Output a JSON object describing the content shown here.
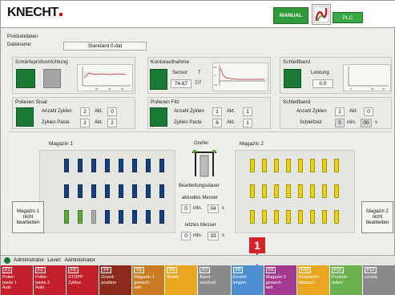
{
  "header": {
    "logo": "KNECHT",
    "manual_label": "MANUAL",
    "plc_label": "PLC",
    "colors": {
      "manual": "#2e9a3a",
      "plc": "#38a845",
      "logo_dot": "#d11111"
    }
  },
  "product": {
    "title": "Produktdaten",
    "file_label": "Dateiname:",
    "file_value": "Standard 0.dat"
  },
  "sections": {
    "sharpness": {
      "title": "Schärfeprüfvorrichtung"
    },
    "contour": {
      "title": "Konturaufnahme",
      "sensor_label": "Sensor",
      "sensor_unit": "T",
      "value1": "74.67",
      "value2": "7/7"
    },
    "belt1": {
      "title": "Schleifband",
      "power_label": "Leistung",
      "power_value": "0.0"
    },
    "sisal": {
      "title": "Polieren Sisal",
      "cycles_label": "Anzahl Zyklen",
      "cycles_value": "2",
      "akt_label": "Akt.",
      "cycles_akt": "0",
      "paste_label": "Zyklen Paste",
      "paste_value": "2",
      "paste_akt": "2"
    },
    "filz": {
      "title": "Polieren Filz",
      "cycles_label": "Anzahl Zyklen",
      "cycles_value": "1",
      "akt_label": "Akt.",
      "cycles_akt": "1",
      "paste_label": "Zyklen Paste",
      "paste_value": "6",
      "paste_akt": "1"
    },
    "belt2": {
      "title": "Schleifband",
      "cycles_label": "Anzahl Zyklen",
      "cycles_value": "1",
      "akt_label": "Akt.",
      "cycles_akt": "0",
      "time_label": "Schleifzeit",
      "min_value": "0",
      "min_label": "min.",
      "sec_value": "00",
      "sec_label": "s"
    }
  },
  "magazines": {
    "m1_title": "Magazin 1",
    "m2_title": "Magazin 2",
    "gripper_label": "Greifer",
    "duration_label": "Bearbeitungsdauer",
    "current_label": "aktuelles Messer",
    "current_min": "0",
    "current_sec": "04",
    "last_label": "letztes Messer",
    "last_min": "0",
    "last_sec": "33",
    "min_label": "min.",
    "sec_label": "s",
    "m1_button": "Magazin 1\nnicht\nbearbeiten",
    "m2_button": "Magazin 2\nnicht\nbearbeiten",
    "m1_rows": [
      [
        "blue",
        "blue",
        "blue",
        "blue",
        "blue",
        "blue",
        "blue",
        "blue"
      ],
      [
        "blue",
        "blue",
        "blue",
        "blue",
        "blue",
        "blue",
        "blue",
        "blue"
      ],
      [
        "green",
        "green",
        "grey",
        "blue",
        "blue",
        "blue",
        "blue",
        "blue"
      ]
    ],
    "m2_rows": [
      [
        "yellow",
        "yellow",
        "yellow",
        "yellow",
        "yellow",
        "yellow",
        "yellow",
        "yellow"
      ],
      [
        "yellow",
        "yellow",
        "yellow",
        "yellow",
        "yellow",
        "yellow",
        "yellow",
        "yellow"
      ],
      [
        "yellow",
        "yellow",
        "yellow",
        "yellow",
        "yellow",
        "yellow",
        "yellow",
        "yellow"
      ]
    ]
  },
  "status": {
    "user": "Administrator",
    "level_label": "Level:",
    "level_value": "Administrator"
  },
  "badge": "1",
  "fkeys": [
    {
      "key": "F1",
      "label": "Polier-\npaste 1\nAuto",
      "color": "#c21f2a"
    },
    {
      "key": "F2",
      "label": "Polier-\npaste 2\nAuto",
      "color": "#c21f2a"
    },
    {
      "key": "F3",
      "label": "STOPP\nZyklus",
      "color": "#c21f2a"
    },
    {
      "key": "F4",
      "label": "Grund-\nposition",
      "color": "#8c2a1c"
    },
    {
      "key": "F5",
      "label": "Magazin 1\ngewech-\nselt",
      "color": "#c97a23"
    },
    {
      "key": "F6",
      "label": "Reset",
      "color": "#e8a51f"
    },
    {
      "key": "F7",
      "label": "Band-\nwechsel",
      "color": "#8a8a8a"
    },
    {
      "key": "F8",
      "label": "Einstel-\nlungen",
      "color": "#4d8fd1"
    },
    {
      "key": "F9",
      "label": "Magazin 2\ngewech-\nselt",
      "color": "#a13a8e"
    },
    {
      "key": "F10",
      "label": "Programm\nAbbruch",
      "color": "#e8a51f"
    },
    {
      "key": "F11",
      "label": "Produkt-\ndaten",
      "color": "#6ab04c"
    },
    {
      "key": "F12",
      "label": "zurück",
      "color": "#8a8a8a"
    }
  ]
}
